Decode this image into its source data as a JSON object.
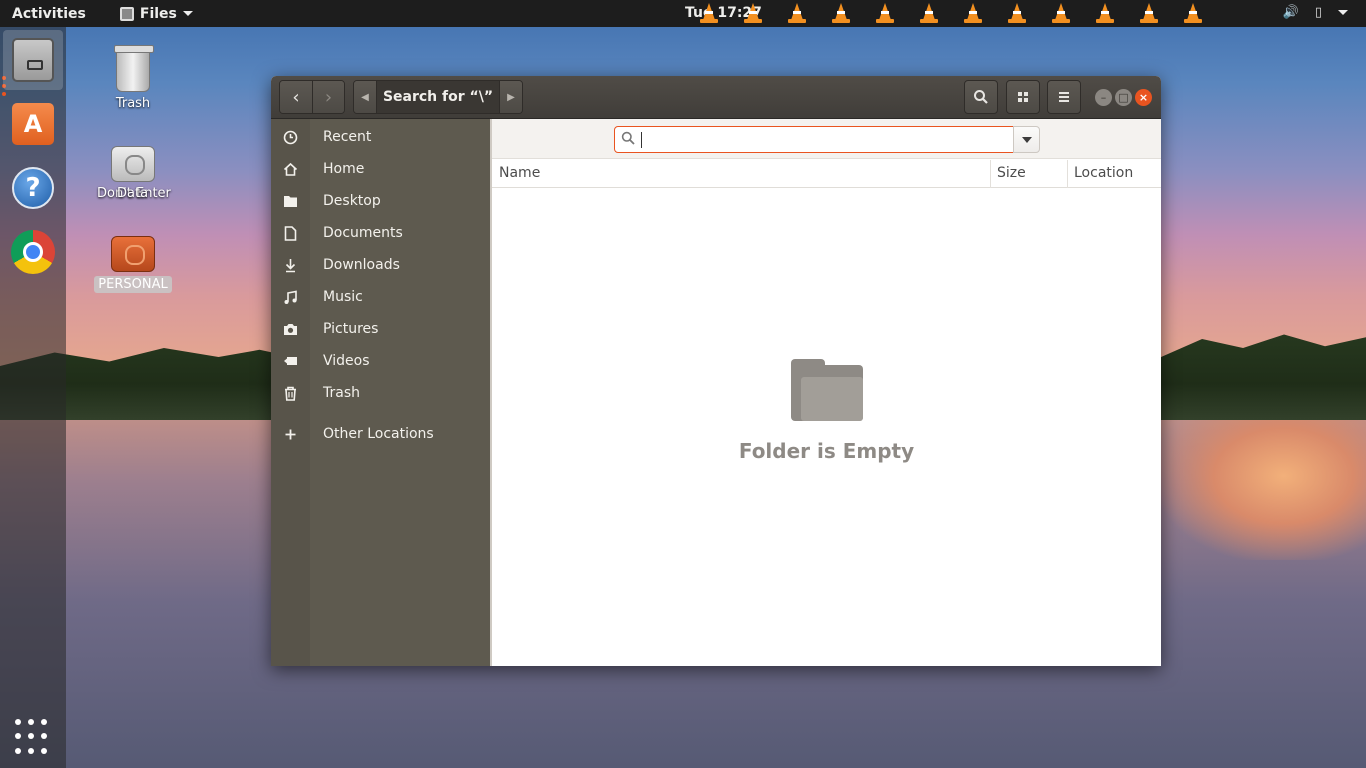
{
  "topbar": {
    "activities": "Activities",
    "app_name": "Files",
    "clock": "Tue 17:27",
    "tray_icons": [
      "vlc-cone",
      "vlc-cone",
      "vlc-cone",
      "vlc-cone",
      "vlc-cone",
      "vlc-cone",
      "vlc-cone",
      "vlc-cone",
      "vlc-cone",
      "vlc-cone",
      "vlc-cone",
      "vlc-cone",
      "vlc-cone"
    ]
  },
  "dock": {
    "apps": [
      "files",
      "ubuntu-software",
      "help",
      "google-chrome"
    ]
  },
  "desktop": {
    "icons": [
      {
        "label": "Trash"
      },
      {
        "label": "Data",
        "overlay_label": "Don't Enter"
      },
      {
        "label": "PERSONAL"
      }
    ]
  },
  "window": {
    "path_label": "Search for “\\”",
    "search": {
      "value": "",
      "placeholder": ""
    },
    "sidebar": [
      {
        "label": "Recent",
        "icon": "clock-icon"
      },
      {
        "label": "Home",
        "icon": "home-icon"
      },
      {
        "label": "Desktop",
        "icon": "folder-icon"
      },
      {
        "label": "Documents",
        "icon": "document-icon"
      },
      {
        "label": "Downloads",
        "icon": "download-icon"
      },
      {
        "label": "Music",
        "icon": "music-icon"
      },
      {
        "label": "Pictures",
        "icon": "camera-icon"
      },
      {
        "label": "Videos",
        "icon": "video-icon"
      },
      {
        "label": "Trash",
        "icon": "trash-icon"
      },
      {
        "label": "Other Locations",
        "icon": "plus-icon"
      }
    ],
    "columns": {
      "name": "Name",
      "size": "Size",
      "location": "Location"
    },
    "empty_message": "Folder is Empty"
  },
  "colors": {
    "accent": "#e95420",
    "sidebar_bg": "#5e5a4f",
    "headerbar_bg": "#403d39",
    "topbar_bg": "#1d1d1d"
  }
}
